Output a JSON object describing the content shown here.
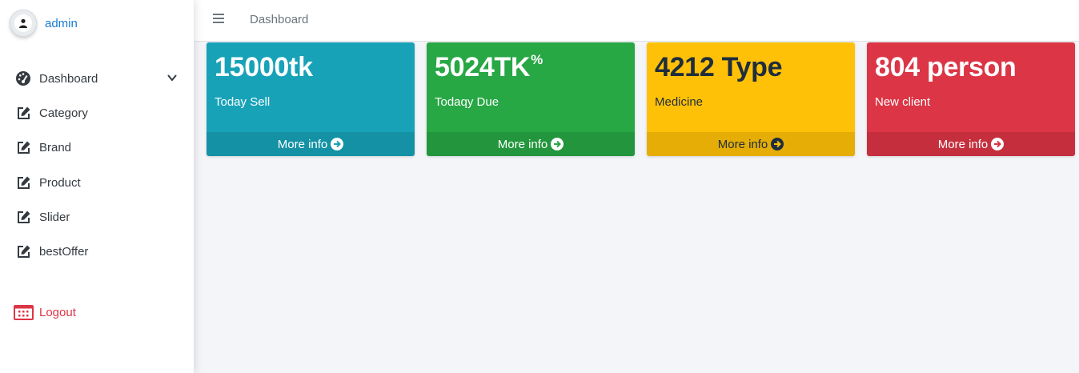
{
  "user": {
    "name": "admin"
  },
  "sidebar": {
    "items": [
      {
        "label": "Dashboard",
        "icon": "dashboard-gauge-icon"
      },
      {
        "label": "Category",
        "icon": "edit-icon"
      },
      {
        "label": "Brand",
        "icon": "edit-icon"
      },
      {
        "label": "Product",
        "icon": "edit-icon"
      },
      {
        "label": "Slider",
        "icon": "edit-icon"
      },
      {
        "label": "bestOffer",
        "icon": "edit-icon"
      }
    ],
    "logout": {
      "label": "Logout",
      "icon": "calendar-icon"
    }
  },
  "topbar": {
    "breadcrumb": "Dashboard"
  },
  "cards": [
    {
      "value": "15000tk",
      "sup": "",
      "label": "Today Sell",
      "footer": "More info",
      "color": "#17a2b8"
    },
    {
      "value": "5024TK",
      "sup": "%",
      "label": "Todaqy Due",
      "footer": "More info",
      "color": "#28a745"
    },
    {
      "value": "4212 Type",
      "sup": "",
      "label": "Medicine",
      "footer": "More info",
      "color": "#ffc107"
    },
    {
      "value": "804 person",
      "sup": "",
      "label": "New client",
      "footer": "More info",
      "color": "#dc3545"
    }
  ],
  "colors": {
    "link": "#1a7bd0",
    "logout": "#dc3545",
    "background": "#f4f5f9"
  }
}
